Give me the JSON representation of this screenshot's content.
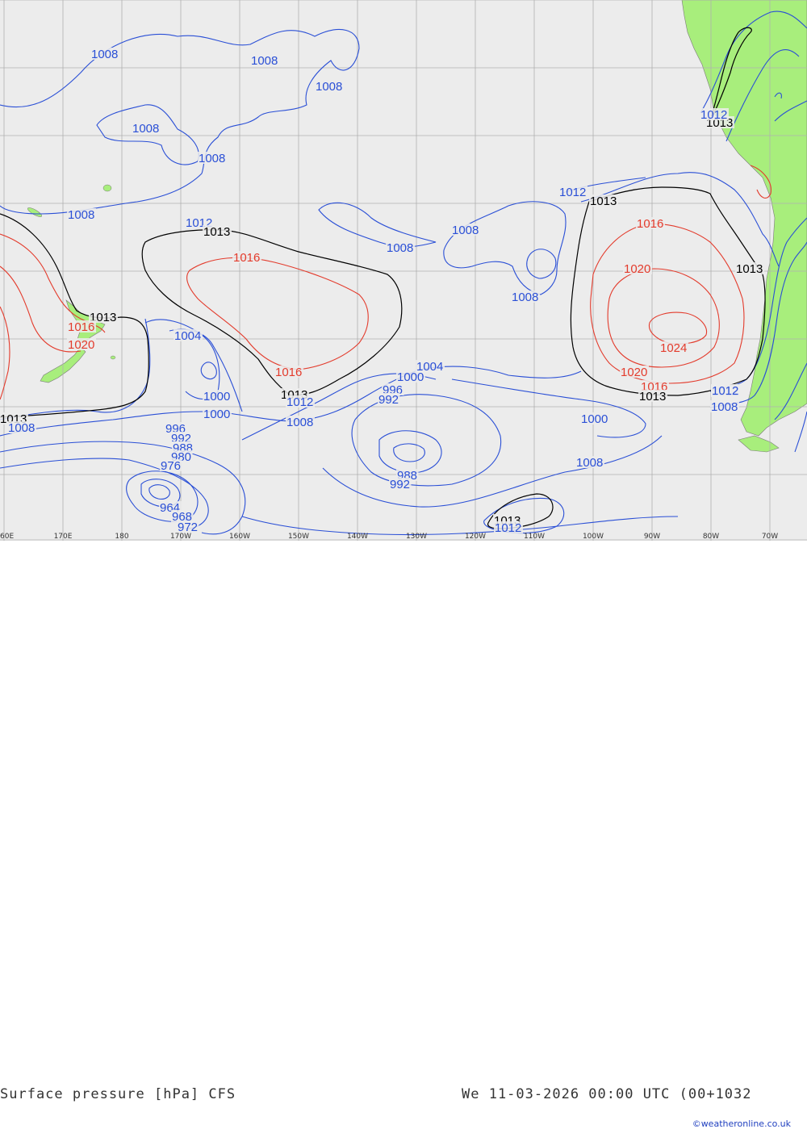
{
  "footer": {
    "title": "Surface pressure [hPa] CFS",
    "valid_time": "We 11-03-2026 00:00 UTC (00+1032",
    "credit": "©weatheronline.co.uk"
  },
  "longitude_ticks": [
    "60E",
    "170E",
    "180",
    "170W",
    "160W",
    "150W",
    "140W",
    "130W",
    "120W",
    "110W",
    "100W",
    "90W",
    "80W",
    "70W"
  ],
  "colors": {
    "ocean": "#ececec",
    "land": "#a8ee7c",
    "grid": "#b0b0b0",
    "below_1013": "#2a4fd6",
    "at_1013": "#000000",
    "above_1013": "#e33b2c"
  },
  "isobar_labels": [
    {
      "text": "1008",
      "level": "low"
    },
    {
      "text": "1008",
      "level": "low"
    },
    {
      "text": "1008",
      "level": "low"
    },
    {
      "text": "1008",
      "level": "low"
    },
    {
      "text": "1008",
      "level": "low"
    },
    {
      "text": "1008",
      "level": "low"
    },
    {
      "text": "1012",
      "level": "low"
    },
    {
      "text": "1013",
      "level": "mid"
    },
    {
      "text": "1016",
      "level": "high"
    },
    {
      "text": "1008",
      "level": "low"
    },
    {
      "text": "1008",
      "level": "low"
    },
    {
      "text": "1008",
      "level": "low"
    },
    {
      "text": "1012",
      "level": "low"
    },
    {
      "text": "1013",
      "level": "mid"
    },
    {
      "text": "1016",
      "level": "high"
    },
    {
      "text": "1020",
      "level": "high"
    },
    {
      "text": "1024",
      "level": "high"
    },
    {
      "text": "1020",
      "level": "high"
    },
    {
      "text": "1016",
      "level": "high"
    },
    {
      "text": "1013",
      "level": "mid"
    },
    {
      "text": "1012",
      "level": "low"
    },
    {
      "text": "1013",
      "level": "mid"
    },
    {
      "text": "1012",
      "level": "low"
    },
    {
      "text": "1013",
      "level": "mid"
    },
    {
      "text": "1013",
      "level": "mid"
    },
    {
      "text": "1016",
      "level": "high"
    },
    {
      "text": "1020",
      "level": "high"
    },
    {
      "text": "1013",
      "level": "mid"
    },
    {
      "text": "1008",
      "level": "low"
    },
    {
      "text": "1004",
      "level": "low"
    },
    {
      "text": "1000",
      "level": "low"
    },
    {
      "text": "1000",
      "level": "low"
    },
    {
      "text": "1016",
      "level": "high"
    },
    {
      "text": "1013",
      "level": "mid"
    },
    {
      "text": "1012",
      "level": "low"
    },
    {
      "text": "1008",
      "level": "low"
    },
    {
      "text": "1004",
      "level": "low"
    },
    {
      "text": "1000",
      "level": "low"
    },
    {
      "text": "996",
      "level": "low"
    },
    {
      "text": "992",
      "level": "low"
    },
    {
      "text": "988",
      "level": "low"
    },
    {
      "text": "992",
      "level": "low"
    },
    {
      "text": "1000",
      "level": "low"
    },
    {
      "text": "1008",
      "level": "low"
    },
    {
      "text": "1013",
      "level": "mid"
    },
    {
      "text": "1012",
      "level": "low"
    },
    {
      "text": "996",
      "level": "low"
    },
    {
      "text": "992",
      "level": "low"
    },
    {
      "text": "988",
      "level": "low"
    },
    {
      "text": "980",
      "level": "low"
    },
    {
      "text": "976",
      "level": "low"
    },
    {
      "text": "964",
      "level": "low"
    },
    {
      "text": "968",
      "level": "low"
    },
    {
      "text": "972",
      "level": "low"
    },
    {
      "text": "1012",
      "level": "low"
    },
    {
      "text": "1008",
      "level": "low"
    }
  ]
}
